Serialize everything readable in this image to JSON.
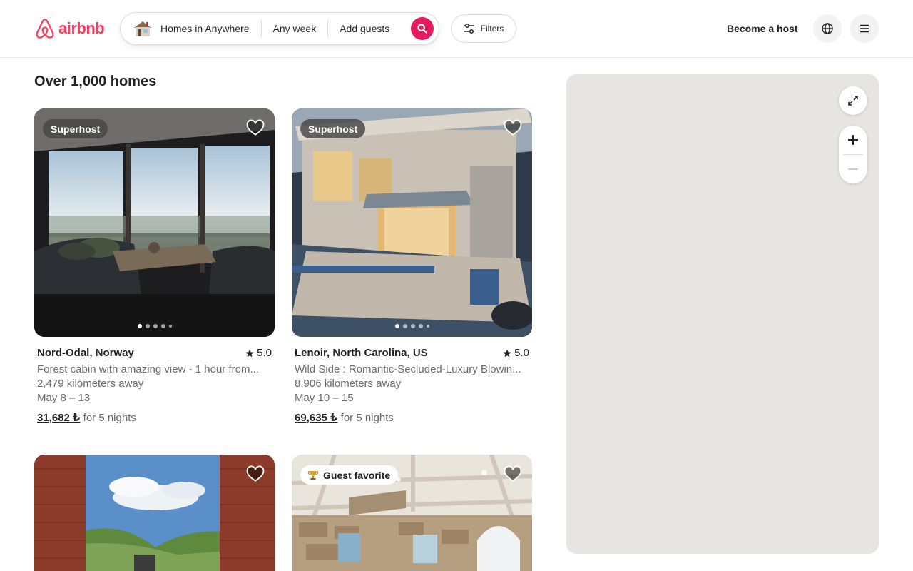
{
  "header": {
    "brand": "airbnb",
    "search": {
      "where": "Homes in Anywhere",
      "when": "Any week",
      "who": "Add guests"
    },
    "filters_label": "Filters",
    "host_label": "Become a host"
  },
  "results": {
    "title": "Over 1,000 homes"
  },
  "listings": [
    {
      "badge": "Superhost",
      "location": "Nord-Odal, Norway",
      "rating": "5.0",
      "description": "Forest cabin with amazing view - 1 hour from...",
      "distance": "2,479 kilometers away",
      "dates": "May 8 – 13",
      "price": "31,682 ₺",
      "price_suffix": "for 5 nights"
    },
    {
      "badge": "Superhost",
      "location": "Lenoir, North Carolina, US",
      "rating": "5.0",
      "description": "Wild Side : Romantic-Secluded-Luxury Blowin...",
      "distance": "8,906 kilometers away",
      "dates": "May 10 – 15",
      "price": "69,635 ₺",
      "price_suffix": "for 5 nights"
    },
    {
      "badge": ""
    },
    {
      "badge": "Guest favorite"
    }
  ],
  "colors": {
    "brand": "#ff385c",
    "search_button": "#e31c5f",
    "map_background": "#e6e5e2"
  },
  "icons": [
    "airbnb-logo-icon",
    "house-icon",
    "search-icon",
    "filters-icon",
    "globe-icon",
    "hamburger-menu-icon",
    "heart-icon",
    "star-icon",
    "trophy-icon",
    "expand-icon",
    "plus-icon",
    "minus-icon"
  ]
}
